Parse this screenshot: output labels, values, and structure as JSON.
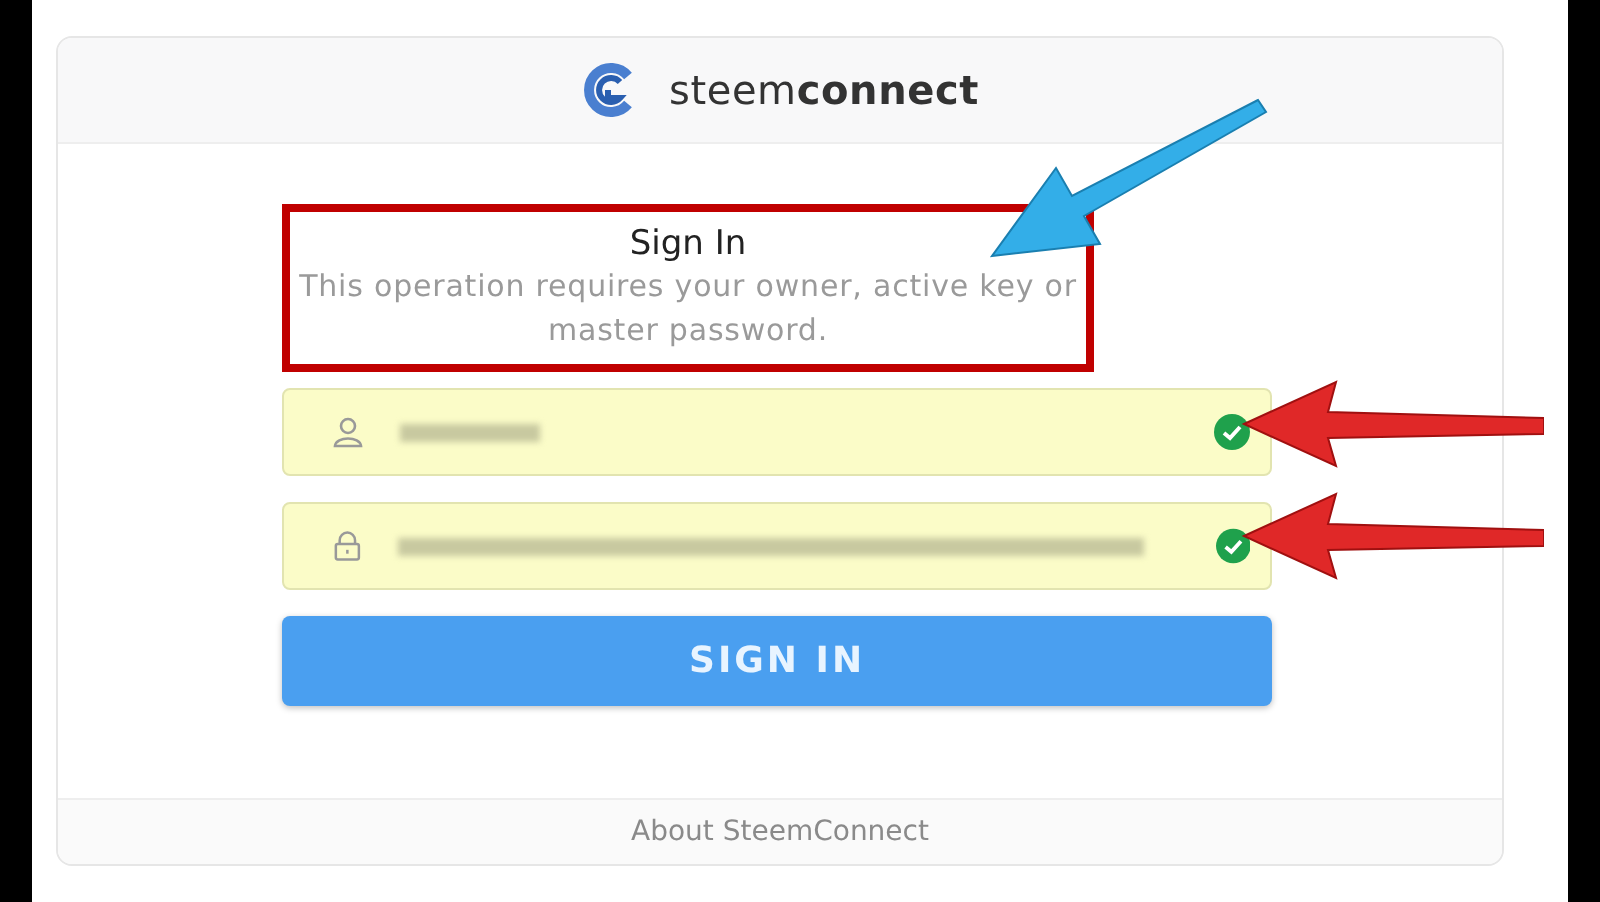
{
  "header": {
    "logo_text": "steem**connect**"
  },
  "notice": {
    "title": "Sign In",
    "message": "This operation requires your owner, active key or master password.",
    "highlighted": true
  },
  "fields": [
    {
      "kind": "username",
      "obscured": true,
      "valid": true,
      "annotated": true
    },
    {
      "kind": "password",
      "obscured": true,
      "valid": true,
      "annotated": true
    }
  ],
  "button": {
    "label": "SIGN IN"
  },
  "footer": {
    "link": "About SteemConnect"
  },
  "callout_arrow": true
}
